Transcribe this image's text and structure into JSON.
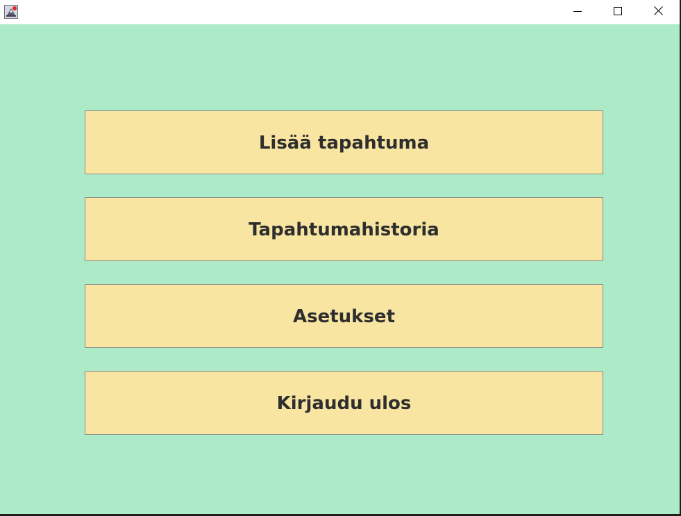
{
  "window": {
    "icon": "java-app-icon",
    "controls": {
      "minimize_icon": "minimize-icon",
      "maximize_icon": "maximize-icon",
      "close_icon": "close-icon"
    }
  },
  "menu": {
    "items": [
      {
        "label": "Lisää tapahtuma"
      },
      {
        "label": "Tapahtumahistoria"
      },
      {
        "label": "Asetukset"
      },
      {
        "label": "Kirjaudu ulos"
      }
    ]
  },
  "colors": {
    "background": "#adebc8",
    "button_fill": "#f7e5a1",
    "button_border": "#8a8a8a",
    "button_text": "#2e2e2e",
    "titlebar": "#ffffff"
  }
}
